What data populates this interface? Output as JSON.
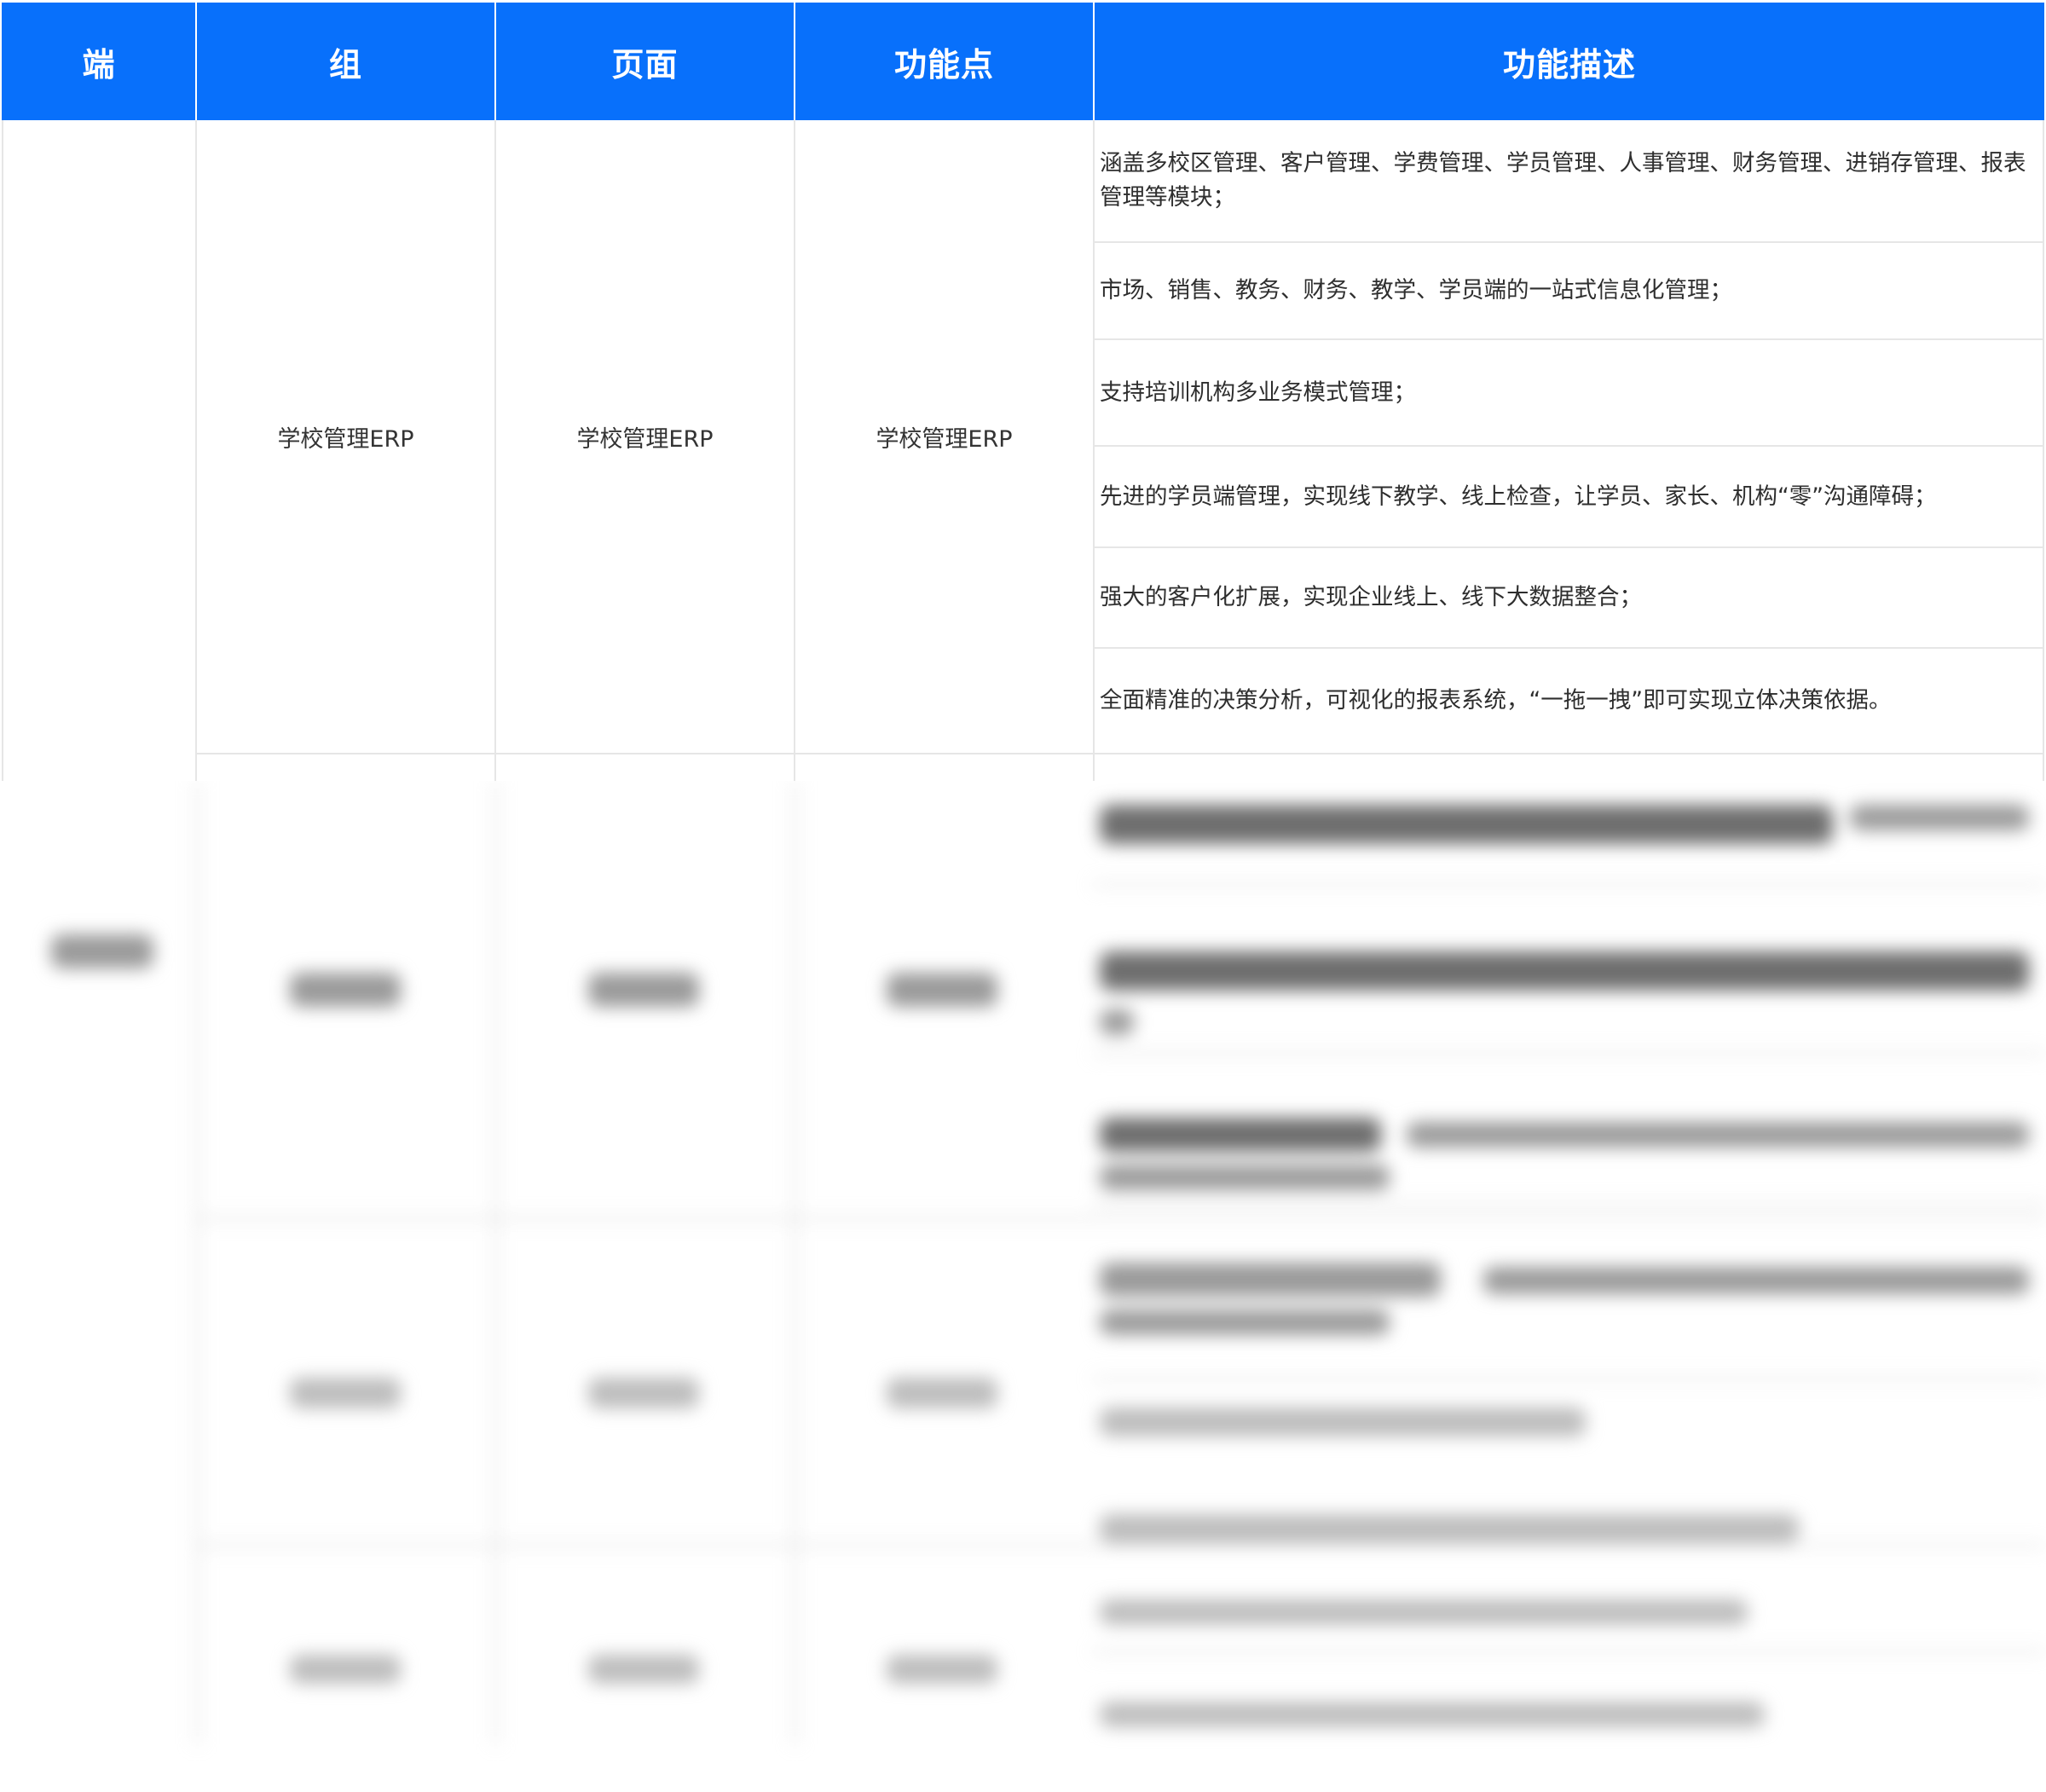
{
  "table": {
    "headers": {
      "client": "端",
      "group": "组",
      "page": "页面",
      "feature": "功能点",
      "description": "功能描述"
    },
    "rows": [
      {
        "group": "学校管理ERP",
        "page": "学校管理ERP",
        "feature": "学校管理ERP",
        "descriptions": [
          "涵盖多校区管理、客户管理、学费管理、学员管理、人事管理、财务管理、进销存管理、报表管理等模块；",
          "市场、销售、教务、财务、教学、学员端的一站式信息化管理；",
          "支持培训机构多业务模式管理；",
          "先进的学员端管理，实现线下教学、线上检查，让学员、家长、机构“零”沟通障碍；",
          "强大的客户化扩展，实现企业线上、线下大数据整合；",
          "全面精准的决策分析，可视化的报表系统，“一拖一拽”即可实现立体决策依据。"
        ]
      }
    ]
  },
  "colors": {
    "header_bg": "#0870fb",
    "header_text": "#ffffff",
    "grid_line": "#e6e6e6",
    "body_text": "#333333"
  }
}
